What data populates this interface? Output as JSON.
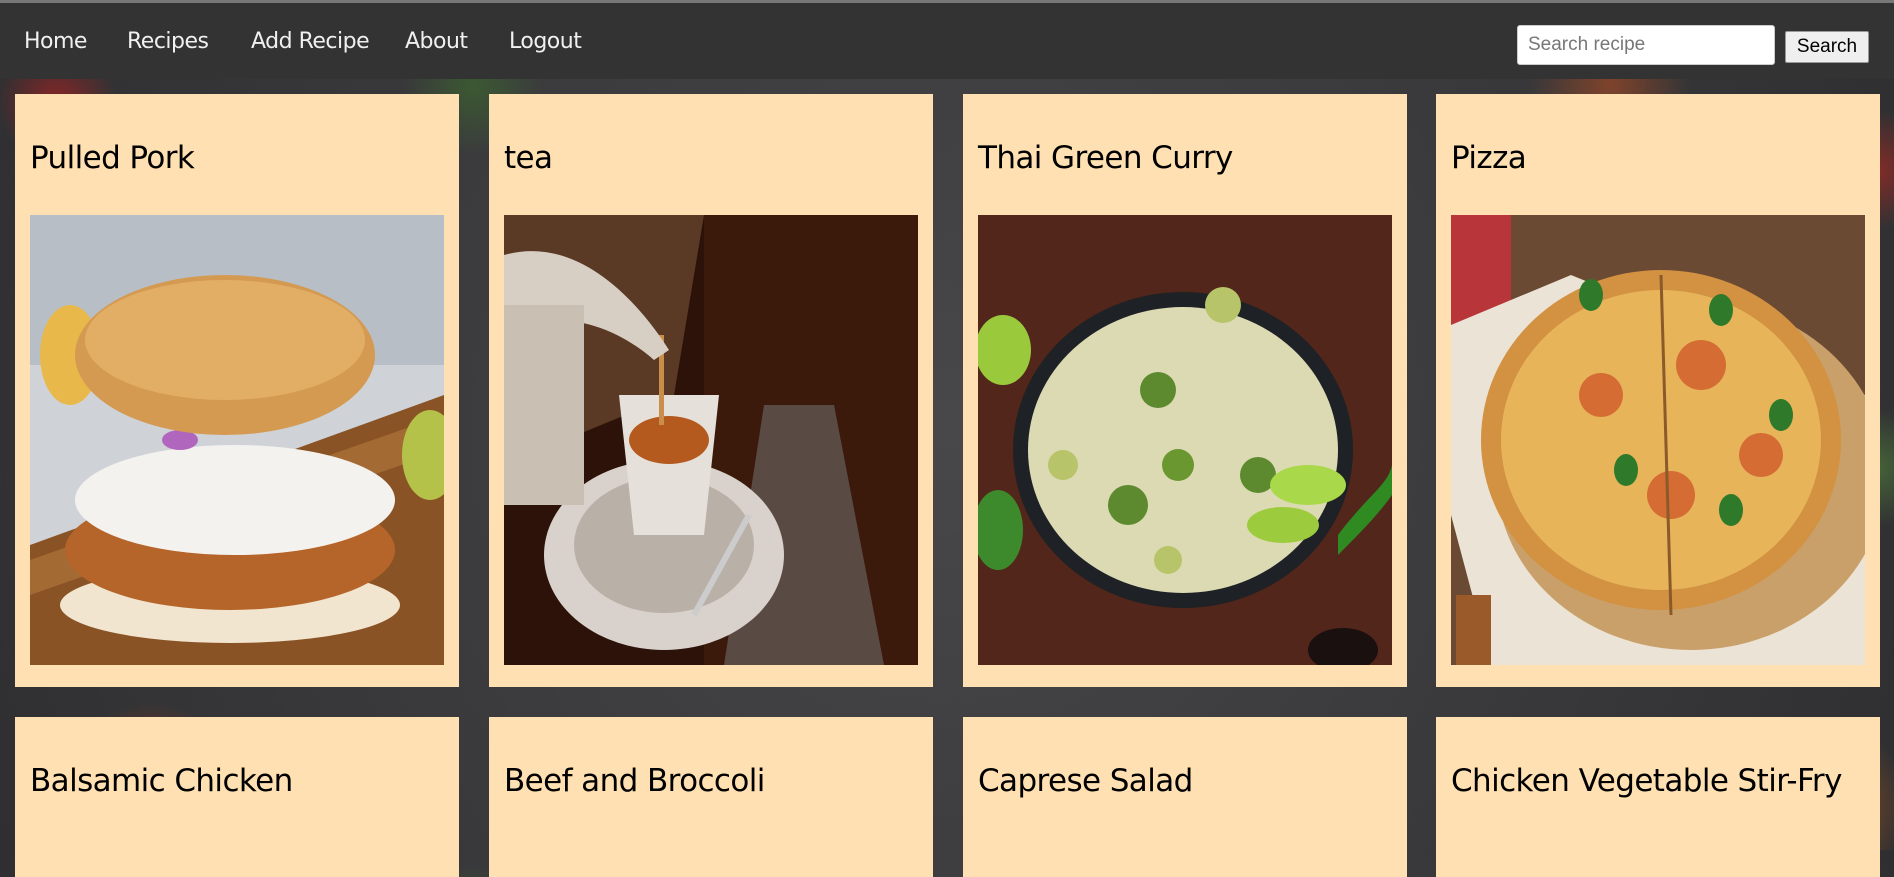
{
  "nav": {
    "links": [
      {
        "label": "Home"
      },
      {
        "label": "Recipes"
      },
      {
        "label": "Add Recipe"
      },
      {
        "label": "About"
      },
      {
        "label": "Logout"
      }
    ],
    "search": {
      "placeholder": "Search recipe",
      "value": "",
      "button_label": "Search"
    }
  },
  "recipes": [
    {
      "title": "Pulled Pork"
    },
    {
      "title": "tea"
    },
    {
      "title": "Thai Green Curry"
    },
    {
      "title": "Pizza"
    },
    {
      "title": "Balsamic Chicken"
    },
    {
      "title": "Beef and Broccoli"
    },
    {
      "title": "Caprese Salad"
    },
    {
      "title": "Chicken Vegetable Stir-Fry"
    }
  ],
  "colors": {
    "navbar": "#333333",
    "card_background": "#ffe0b2",
    "nav_text": "#f0f0f0"
  }
}
